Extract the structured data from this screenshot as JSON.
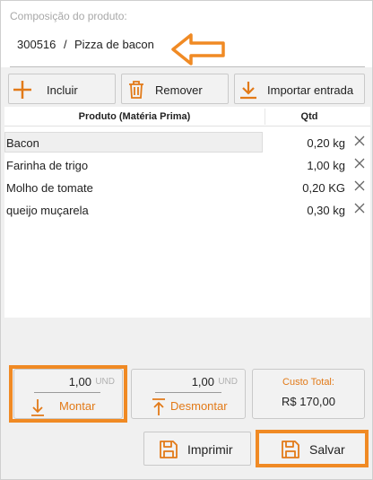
{
  "window": {
    "title": "Composição do produto:"
  },
  "product": {
    "code": "300516",
    "separator": "/",
    "name": "Pizza de bacon"
  },
  "toolbar": {
    "add_label": "Incluir",
    "remove_label": "Remover",
    "import_label": "Importar entrada"
  },
  "grid": {
    "columns": {
      "product": "Produto (Matéria Prima)",
      "qty": "Qtd"
    },
    "rows": [
      {
        "name": "Bacon",
        "qty": "0,20 kg"
      },
      {
        "name": "Farinha de trigo",
        "qty": "1,00 kg"
      },
      {
        "name": "Molho de tomate",
        "qty": "0,20 KG"
      },
      {
        "name": "queijo muçarela",
        "qty": "0,30 kg"
      }
    ]
  },
  "montar": {
    "qty": "1,00",
    "unit": "UND",
    "action_label": "Montar"
  },
  "desmontar": {
    "qty": "1,00",
    "unit": "UND",
    "action_label": "Desmontar"
  },
  "cost": {
    "title": "Custo Total:",
    "value": "R$ 170,00"
  },
  "actions": {
    "print_label": "Imprimir",
    "save_label": "Salvar"
  },
  "colors": {
    "accent": "#e27a18",
    "annotation": "#f08a24"
  },
  "icons": {
    "toolbar": [
      "plus-icon",
      "trash-icon",
      "download-icon"
    ],
    "row_delete": "close-icon",
    "montar": "arrow-down-icon",
    "desmontar": "arrow-up-icon",
    "bottom": [
      "save-icon",
      "save-icon"
    ],
    "annotation": "arrow-left-icon"
  }
}
